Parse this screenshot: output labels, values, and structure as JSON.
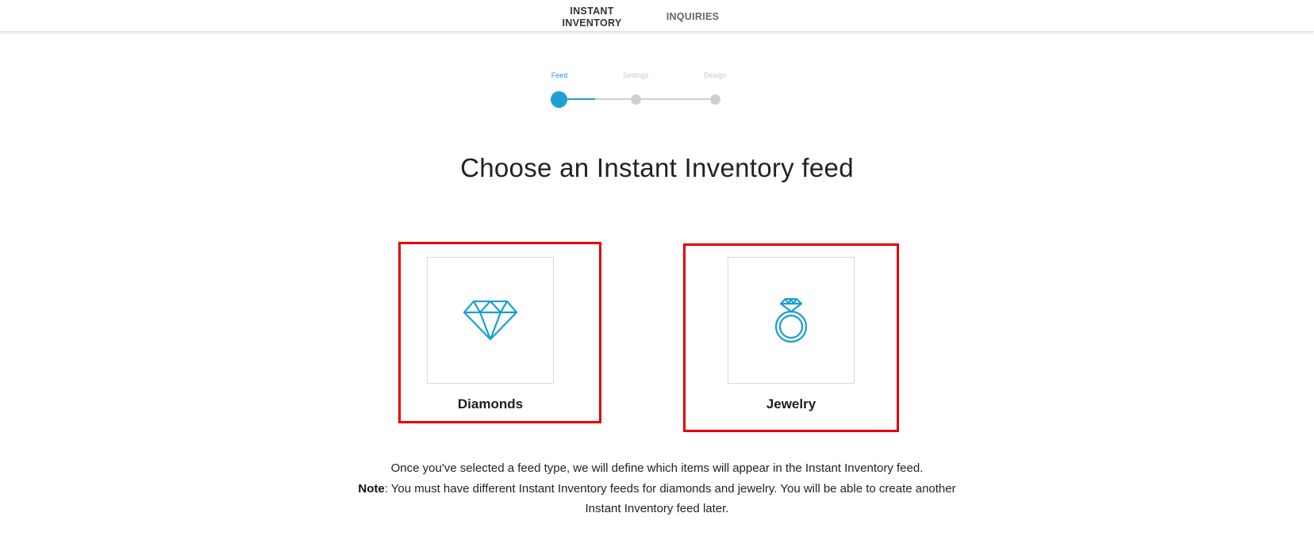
{
  "nav": {
    "tabs": [
      {
        "label": "INSTANT\nINVENTORY",
        "active": true
      },
      {
        "label": "INQUIRIES",
        "active": false
      }
    ]
  },
  "stepper": {
    "steps": [
      {
        "label": "Feed",
        "state": "active"
      },
      {
        "label": "Settings",
        "state": "pending"
      },
      {
        "label": "Design",
        "state": "pending"
      }
    ],
    "active_color": "#1f9fd4",
    "pending_color": "#cfcfcf"
  },
  "heading": "Choose an Instant Inventory feed",
  "options": [
    {
      "label": "Diamonds",
      "icon": "diamond-icon"
    },
    {
      "label": "Jewelry",
      "icon": "ring-icon"
    }
  ],
  "highlight_color": "#e50000",
  "info": {
    "line1": "Once you've selected a feed type, we will define which items will appear in the Instant Inventory feed.",
    "note_label": "Note",
    "note_text": ": You must have different Instant Inventory feeds for diamonds and jewelry. You will be able to create another Instant Inventory feed later."
  }
}
